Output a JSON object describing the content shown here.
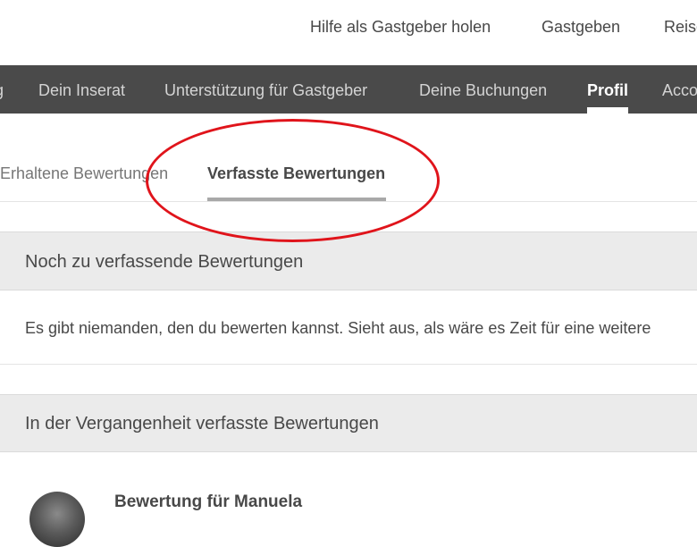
{
  "header": {
    "links": [
      {
        "label": "Hilfe als Gastgeber holen"
      },
      {
        "label": "Gastgeben"
      },
      {
        "label": "Reise"
      }
    ]
  },
  "navbar": {
    "items": [
      {
        "label": "g"
      },
      {
        "label": "Dein Inserat"
      },
      {
        "label": "Unterstützung für Gastgeber"
      },
      {
        "label": "Deine Buchungen"
      },
      {
        "label": "Profil",
        "active": true
      },
      {
        "label": "Acco"
      }
    ]
  },
  "subtabs": [
    {
      "label": "Erhaltene Bewertungen",
      "active": false
    },
    {
      "label": "Verfasste Bewertungen",
      "active": true
    }
  ],
  "sections": {
    "pending": {
      "title": "Noch zu verfassende Bewertungen",
      "message": "Es gibt niemanden, den du bewerten kannst. Sieht aus, als wäre es Zeit für eine weitere"
    },
    "past": {
      "title": "In der Vergangenheit verfasste Bewertungen",
      "reviews": [
        {
          "title": "Bewertung für Manuela"
        }
      ]
    }
  },
  "colors": {
    "navbar_bg": "#4a4a4a",
    "section_bg": "#ebebeb",
    "annotation": "#e0141b",
    "tab_underline": "#a8a8a8"
  }
}
